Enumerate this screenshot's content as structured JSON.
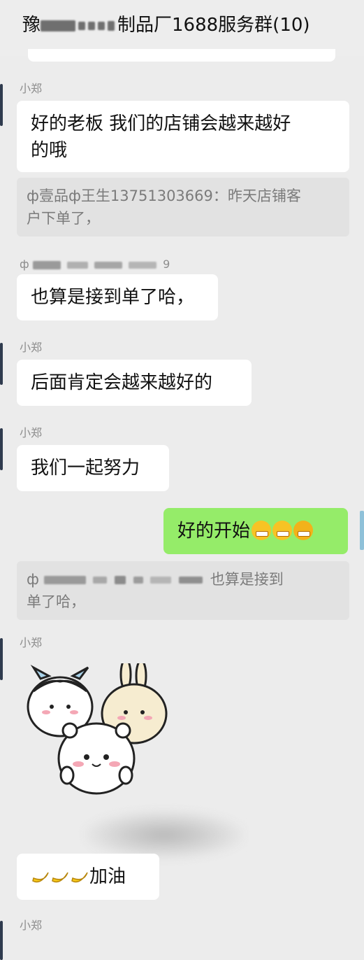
{
  "header": {
    "title_prefix": "豫",
    "title_suffix": "制品厂1688服务群(10)"
  },
  "messages": [
    {
      "sender": "小郑",
      "text_line1": "好的老板 我们的店铺会越来越好",
      "text_line2": "的哦"
    },
    {
      "quote_line1": "ф壹品ф王生13751303669：昨天店铺客",
      "quote_line2": "户下单了，"
    },
    {
      "sender_prefix": "ф",
      "sender_suffix": "9",
      "text": "也算是接到单了哈，"
    },
    {
      "sender": "小郑",
      "text": "后面肯定会越来越好的"
    },
    {
      "sender": "小郑",
      "text": "我们一起努力"
    },
    {
      "self_text": "好的开始",
      "emojis": [
        "grin-emoji",
        "grin-emoji",
        "headband-emoji"
      ]
    },
    {
      "quote_prefix": "ф",
      "quote_line1": "也算是接到",
      "quote_line2": "单了哈，"
    },
    {
      "sender": "小郑",
      "sticker": "three-cute-characters-sticker"
    },
    {
      "text": "加油",
      "emojis": [
        "banana-emoji",
        "banana-emoji",
        "banana-emoji"
      ]
    },
    {
      "sender": "小郑"
    }
  ]
}
